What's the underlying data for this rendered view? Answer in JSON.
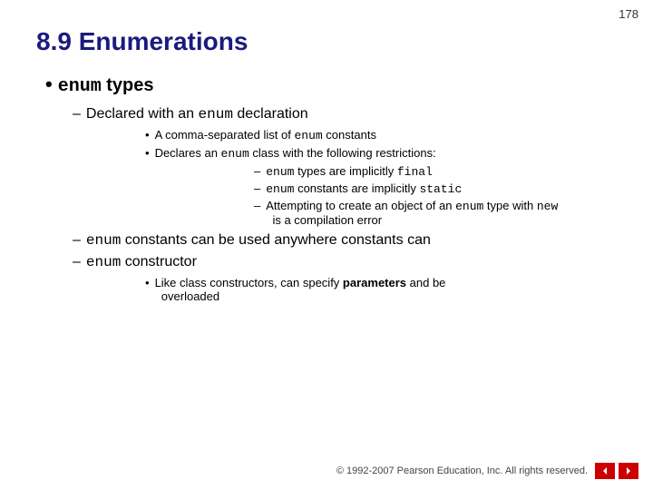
{
  "page": {
    "number": "178",
    "title_prefix": "8.9  ",
    "title_main": "Enumerations"
  },
  "content": {
    "bullet_main_label": "• enum types",
    "sub1": {
      "dash": "–",
      "text_pre": "Declared with an ",
      "text_code": "enum",
      "text_post": " declaration",
      "sub2a": {
        "bullet": "•",
        "text": "A comma-separated list of ",
        "text_code": "enum",
        "text_post": " constants"
      },
      "sub2b": {
        "bullet": "•",
        "text_pre": "Declares an ",
        "text_code": "enum",
        "text_post": " class with the following restrictions:",
        "sub3a": {
          "dash": "–",
          "text_pre": "enum",
          "text_code": " types are implicitly ",
          "text_code2": "final"
        },
        "sub3b": {
          "dash": "–",
          "text_pre": "enum",
          "text_code": " constants are implicitly ",
          "text_code2": "static"
        },
        "sub3c": {
          "dash": "–",
          "text": "Attempting to create an object of an ",
          "text_code": "enum",
          "text_mid": " type with ",
          "text_code2": "new",
          "text_post": "",
          "line2": "is a compilation error"
        }
      }
    },
    "sub_enum_constants": {
      "dash": "–",
      "text_pre": "enum",
      "text_post": " constants can be used anywhere constants can"
    },
    "sub_enum_constructor": {
      "dash": "–",
      "text_pre": "enum",
      "text_post": " constructor",
      "sub_bullet": {
        "bullet": "•",
        "text": "Like class constructors, can specify ",
        "text_bold": "parameters",
        "text_mid": " and be",
        "line2": "overloaded"
      }
    }
  },
  "footer": {
    "copyright": "© 1992-2007 Pearson Education, Inc.  All rights reserved."
  }
}
